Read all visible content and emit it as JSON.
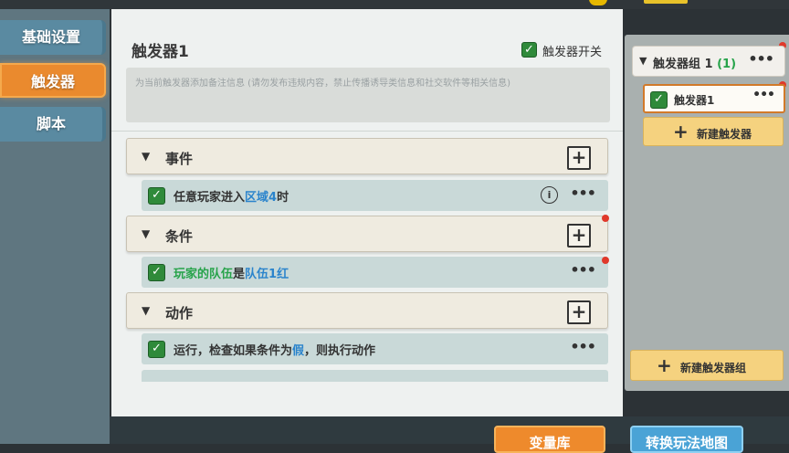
{
  "left_tabs": [
    {
      "label": "基础设置",
      "active": false
    },
    {
      "label": "触发器",
      "active": true
    },
    {
      "label": "脚本",
      "active": false
    }
  ],
  "trigger": {
    "title": "触发器1",
    "toggle_label": "触发器开关",
    "toggle_checked": true,
    "remark_placeholder": "为当前触发器添加备注信息 (请勿发布违规内容，禁止传播诱导类信息和社交软件等相关信息)"
  },
  "sections": {
    "events": {
      "label": "事件",
      "row": {
        "prefix": "任意玩家进入",
        "highlight": "区域4",
        "suffix": "时"
      }
    },
    "conditions": {
      "label": "条件",
      "row": {
        "prefix": "玩家的队伍",
        "mid": "是",
        "highlight": "队伍1红"
      }
    },
    "actions": {
      "label": "动作",
      "row": {
        "prefix": "运行，检查如果条件为",
        "highlight": "假",
        "suffix": "，则执行动作"
      }
    }
  },
  "right_panel": {
    "group_label": "触发器组 1",
    "group_count": "(1)",
    "trigger_item": "触发器1",
    "new_trigger_button": "新建触发器",
    "new_group_button": "新建触发器组"
  },
  "bottom_buttons": {
    "variable_library": "变量库",
    "switch_map": "转换玩法地图"
  },
  "colors": {
    "accent_orange": "#ea8a2e",
    "link_blue": "#2b84cc",
    "link_green": "#27a34a",
    "checkbox_green": "#2f8a3a"
  }
}
